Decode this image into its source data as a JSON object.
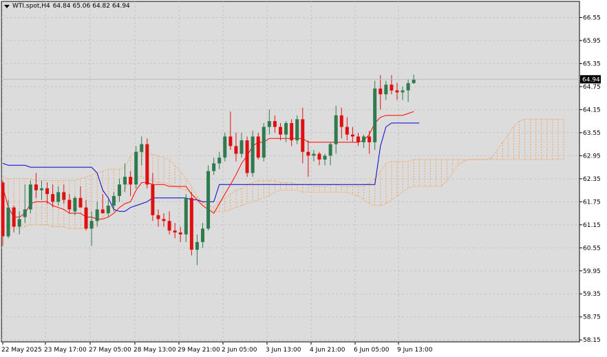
{
  "header": {
    "symbol": "WTI.spot,H4",
    "open": "64.84",
    "high": "65.06",
    "low": "64.82",
    "close": "64.94"
  },
  "colors": {
    "background": "#dcdcdc",
    "grid": "#c4c4c4",
    "bull": "#2f7a4f",
    "bear": "#e01010",
    "tenkan": "#ff0000",
    "kijun": "#0000cd",
    "cloud": "#f4a460",
    "price_label_bg": "#000000"
  },
  "chart_data": {
    "type": "candlestick",
    "title": "",
    "ylim": [
      58.1,
      66.97
    ],
    "y_ticks": [
      "66.55",
      "65.95",
      "65.35",
      "64.75",
      "64.15",
      "63.55",
      "62.95",
      "62.35",
      "61.75",
      "61.15",
      "60.55",
      "59.95",
      "59.35",
      "58.75",
      "58.15"
    ],
    "x_ticks": [
      "22 May 2025",
      "23 May 17:00",
      "27 May 05:00",
      "28 May 13:00",
      "29 May 21:00",
      "2 Jun 05:00",
      "3 Jun 13:00",
      "4 Jun 21:00",
      "6 Jun 05:00",
      "9 Jun 13:00"
    ],
    "current_price": "64.94",
    "candles": [
      [
        62.25,
        62.3,
        60.6,
        60.85
      ],
      [
        60.85,
        61.8,
        60.8,
        61.6
      ],
      [
        61.6,
        61.65,
        60.95,
        61.1
      ],
      [
        61.1,
        61.5,
        60.9,
        61.3
      ],
      [
        61.35,
        62.2,
        61.2,
        61.55
      ],
      [
        61.55,
        62.3,
        61.45,
        62.2
      ],
      [
        62.2,
        62.5,
        61.85,
        62.05
      ],
      [
        62.05,
        62.3,
        61.8,
        62.1
      ],
      [
        62.1,
        62.25,
        61.7,
        61.95
      ],
      [
        61.95,
        62.2,
        61.6,
        61.75
      ],
      [
        61.75,
        62.15,
        61.65,
        62.0
      ],
      [
        62.0,
        62.2,
        61.7,
        61.8
      ],
      [
        61.8,
        61.95,
        61.45,
        61.55
      ],
      [
        61.5,
        61.9,
        61.4,
        61.85
      ],
      [
        61.85,
        62.15,
        61.7,
        61.6
      ],
      [
        61.6,
        61.8,
        61.0,
        61.05
      ],
      [
        61.05,
        61.5,
        60.6,
        61.25
      ],
      [
        61.25,
        61.75,
        61.1,
        61.55
      ],
      [
        61.55,
        61.95,
        61.45,
        61.45
      ],
      [
        61.45,
        61.8,
        61.35,
        61.65
      ],
      [
        61.65,
        62.0,
        61.5,
        61.9
      ],
      [
        61.9,
        62.35,
        61.75,
        62.2
      ],
      [
        62.2,
        62.75,
        62.0,
        62.4
      ],
      [
        62.4,
        62.55,
        61.9,
        62.2
      ],
      [
        62.2,
        63.2,
        62.1,
        63.05
      ],
      [
        63.05,
        63.45,
        62.7,
        63.25
      ],
      [
        63.25,
        63.4,
        62.1,
        62.2
      ],
      [
        62.2,
        62.5,
        61.25,
        61.4
      ],
      [
        61.4,
        61.55,
        61.1,
        61.3
      ],
      [
        61.3,
        61.45,
        61.1,
        61.25
      ],
      [
        61.25,
        61.5,
        60.9,
        61.0
      ],
      [
        61.0,
        61.2,
        60.8,
        60.95
      ],
      [
        60.95,
        61.1,
        60.7,
        60.9
      ],
      [
        60.9,
        61.95,
        60.7,
        61.85
      ],
      [
        61.85,
        62.0,
        60.35,
        60.5
      ],
      [
        60.5,
        60.9,
        60.1,
        60.7
      ],
      [
        60.7,
        61.2,
        60.55,
        61.05
      ],
      [
        61.05,
        62.7,
        61.0,
        62.55
      ],
      [
        62.55,
        62.9,
        62.45,
        62.75
      ],
      [
        62.75,
        63.05,
        62.6,
        62.9
      ],
      [
        62.9,
        63.55,
        62.8,
        63.45
      ],
      [
        63.45,
        64.1,
        63.1,
        63.2
      ],
      [
        63.2,
        63.55,
        62.8,
        63.0
      ],
      [
        63.0,
        63.55,
        62.9,
        63.35
      ],
      [
        63.35,
        63.45,
        62.4,
        62.5
      ],
      [
        62.5,
        63.6,
        62.4,
        63.45
      ],
      [
        63.45,
        63.55,
        62.85,
        62.9
      ],
      [
        62.9,
        63.8,
        62.8,
        63.7
      ],
      [
        63.7,
        64.15,
        63.5,
        63.85
      ],
      [
        63.85,
        64.0,
        63.55,
        63.7
      ],
      [
        63.7,
        63.8,
        63.35,
        63.5
      ],
      [
        63.5,
        63.85,
        63.3,
        63.8
      ],
      [
        63.8,
        63.9,
        63.2,
        63.35
      ],
      [
        63.35,
        64.0,
        63.25,
        63.9
      ],
      [
        63.9,
        64.2,
        62.75,
        63.05
      ],
      [
        63.05,
        63.35,
        62.4,
        62.95
      ],
      [
        62.95,
        63.1,
        62.8,
        63.0
      ],
      [
        63.0,
        63.05,
        62.7,
        62.85
      ],
      [
        62.85,
        63.0,
        62.7,
        62.95
      ],
      [
        62.95,
        63.3,
        62.7,
        63.25
      ],
      [
        63.25,
        64.25,
        63.0,
        64.0
      ],
      [
        64.0,
        64.2,
        63.4,
        63.7
      ],
      [
        63.7,
        63.95,
        63.35,
        63.5
      ],
      [
        63.5,
        63.7,
        63.3,
        63.45
      ],
      [
        63.45,
        63.55,
        63.2,
        63.3
      ],
      [
        63.3,
        63.5,
        63.15,
        63.45
      ],
      [
        63.45,
        63.6,
        63.0,
        63.3
      ],
      [
        63.3,
        64.9,
        63.1,
        64.7
      ],
      [
        64.7,
        65.05,
        64.15,
        64.55
      ],
      [
        64.55,
        64.9,
        64.4,
        64.8
      ],
      [
        64.8,
        65.05,
        64.55,
        64.65
      ],
      [
        64.65,
        64.85,
        64.4,
        64.6
      ],
      [
        64.6,
        64.75,
        64.4,
        64.65
      ],
      [
        64.65,
        64.95,
        64.35,
        64.84
      ],
      [
        64.84,
        65.06,
        64.82,
        64.94
      ]
    ],
    "tenkan": [
      62.15,
      61.6,
      61.35,
      61.35,
      61.45,
      61.7,
      61.75,
      61.75,
      61.75,
      61.65,
      61.6,
      61.55,
      61.45,
      61.45,
      61.45,
      61.35,
      61.35,
      61.3,
      61.3,
      61.35,
      61.45,
      61.6,
      61.7,
      61.75,
      62.05,
      62.25,
      62.25,
      62.2,
      62.2,
      62.2,
      62.15,
      62.15,
      62.15,
      62.15,
      61.95,
      61.8,
      61.65,
      61.55,
      61.45,
      61.7,
      61.95,
      62.2,
      62.45,
      62.75,
      62.95,
      63.2,
      63.3,
      63.3,
      63.4,
      63.4,
      63.4,
      63.4,
      63.4,
      63.4,
      63.4,
      63.3,
      63.3,
      63.3,
      63.3,
      63.3,
      63.3,
      63.3,
      63.3,
      63.3,
      63.3,
      63.35,
      63.5,
      63.8,
      63.95,
      64.0,
      64.0,
      64.0,
      64.0,
      64.05,
      64.1
    ],
    "kijun": [
      62.75,
      62.7,
      62.7,
      62.7,
      62.7,
      62.65,
      62.65,
      62.65,
      62.65,
      62.65,
      62.65,
      62.65,
      62.65,
      62.65,
      62.65,
      62.65,
      62.65,
      62.5,
      62.05,
      61.85,
      61.55,
      61.5,
      61.5,
      61.6,
      61.65,
      61.7,
      61.75,
      61.85,
      61.85,
      61.85,
      61.85,
      61.85,
      61.85,
      61.85,
      61.8,
      61.8,
      61.75,
      61.75,
      61.75,
      62.2,
      62.2,
      62.2,
      62.2,
      62.2,
      62.2,
      62.2,
      62.2,
      62.2,
      62.2,
      62.2,
      62.2,
      62.2,
      62.2,
      62.2,
      62.2,
      62.2,
      62.2,
      62.2,
      62.2,
      62.2,
      62.2,
      62.2,
      62.2,
      62.2,
      62.2,
      62.2,
      62.2,
      62.2,
      63.2,
      63.7,
      63.8,
      63.8,
      63.8,
      63.8,
      63.8,
      63.8
    ],
    "cloud_a": [
      61.1,
      61.1,
      61.05,
      61.05,
      61.1,
      61.15,
      61.15,
      61.15,
      61.15,
      61.1,
      61.1,
      61.1,
      61.05,
      61.05,
      61.05,
      61.05,
      61.1,
      61.2,
      61.35,
      61.5,
      61.7,
      61.9,
      62.1,
      62.3,
      62.4,
      62.4,
      62.35,
      62.3,
      62.25,
      62.25,
      62.2,
      62.15,
      62.1,
      62.05,
      61.95,
      61.85,
      61.75,
      61.65,
      61.6,
      61.75,
      61.85,
      61.95,
      62.05,
      62.1,
      62.2,
      62.25,
      62.3,
      62.3,
      62.3,
      62.3,
      62.25,
      62.25,
      62.25,
      62.2,
      62.2,
      62.2,
      62.15,
      62.15,
      62.15,
      62.2,
      62.2,
      62.15,
      62.15,
      62.15,
      62.15,
      62.15,
      62.25,
      62.35,
      62.55,
      62.75,
      62.8,
      62.8,
      62.8,
      62.8,
      62.85,
      62.85,
      62.85,
      62.85,
      62.85,
      62.85,
      62.85,
      62.85,
      62.85,
      62.85,
      62.85,
      62.85,
      62.85,
      62.85,
      62.9,
      63.1,
      63.3,
      63.5,
      63.7,
      63.85,
      63.9,
      63.9,
      63.9,
      63.9,
      63.9,
      63.9,
      63.9,
      63.9
    ],
    "cloud_b": [
      62.4,
      62.35,
      62.35,
      62.35,
      62.35,
      62.35,
      62.3,
      62.3,
      62.3,
      62.3,
      62.3,
      62.3,
      62.3,
      62.3,
      62.35,
      62.4,
      62.45,
      62.5,
      62.55,
      62.6,
      62.6,
      62.6,
      62.65,
      62.95,
      63.05,
      63.05,
      63.0,
      63.0,
      62.95,
      62.9,
      62.85,
      62.7,
      62.55,
      62.35,
      62.15,
      61.9,
      61.7,
      61.6,
      61.5,
      61.5,
      61.5,
      61.55,
      61.6,
      61.65,
      61.7,
      61.75,
      61.8,
      61.85,
      61.9,
      62.0,
      62.05,
      62.05,
      62.05,
      62.05,
      62.0,
      62.0,
      62.0,
      62.0,
      62.0,
      62.0,
      62.0,
      62.0,
      62.0,
      61.95,
      61.9,
      61.8,
      61.7,
      61.65,
      61.65,
      61.7,
      61.8,
      61.9,
      62.0,
      62.1,
      62.15,
      62.15,
      62.15,
      62.15,
      62.15,
      62.15,
      62.3,
      62.5,
      62.7,
      62.8,
      62.85,
      62.85,
      62.85,
      62.85,
      62.85,
      62.85,
      62.85,
      62.85,
      62.85,
      62.85,
      62.85,
      62.85,
      62.85,
      62.85,
      62.85,
      62.85,
      62.85,
      62.85
    ]
  }
}
